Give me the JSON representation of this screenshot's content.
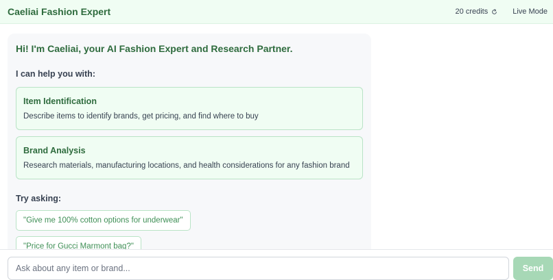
{
  "header": {
    "title": "Caeliai Fashion Expert",
    "credits": "20 credits",
    "credits_icon": "refresh-icon",
    "mode": "Live Mode"
  },
  "message": {
    "greeting": "Hi! I'm Caeliai, your AI Fashion Expert and Research Partner.",
    "help_label": "I can help you with:",
    "capabilities": [
      {
        "title": "Item Identification",
        "description": "Describe items to identify brands, get pricing, and find where to buy"
      },
      {
        "title": "Brand Analysis",
        "description": "Research materials, manufacturing locations, and health considerations for any fashion brand"
      }
    ],
    "try_label": "Try asking:",
    "suggestions": [
      "\"Give me 100% cotton options for underwear\"",
      "\"Price for Gucci Marmont bag?\""
    ]
  },
  "composer": {
    "placeholder": "Ask about any item or brand...",
    "value": "",
    "send_label": "Send"
  },
  "colors": {
    "accent": "#2e6b3d",
    "header_bg": "#f0fdf3",
    "card_border": "#b9e3c6",
    "send_disabled": "#a7d8b6"
  }
}
